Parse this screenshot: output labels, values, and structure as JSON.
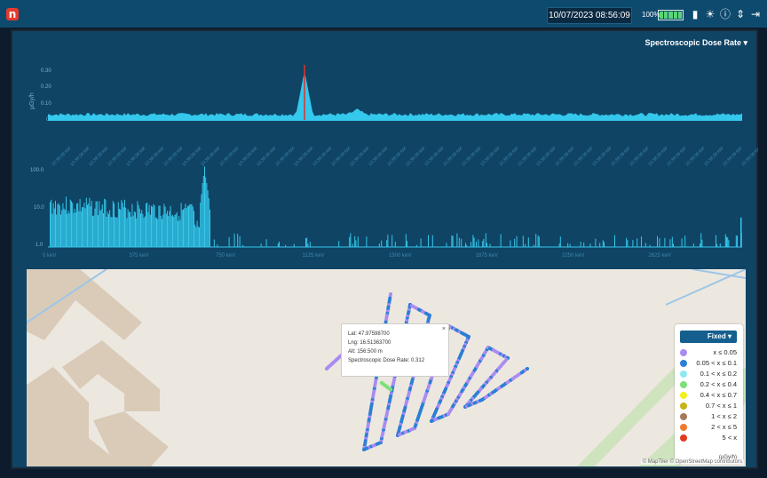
{
  "header": {
    "logo_letter": "n",
    "datetime": "10/07/2023 08:56:09",
    "battery_pct": "100%",
    "battery_level": 1.0
  },
  "colors": {
    "topbar": "#0e4a6e",
    "panel": "#0f4465",
    "series": "#34c8ec",
    "marker": "#e0312b"
  },
  "metric_selector": {
    "label": "Spectroscopic Dose Rate ▾"
  },
  "dose_chart": {
    "y_axis_label": "µGy/h",
    "y_ticks": [
      "0.30",
      "0.20",
      "0.10",
      "0"
    ],
    "ylim": [
      0,
      0.35
    ],
    "x_tick_label_sample": "10:38:09 AM",
    "x_tick_count": 38,
    "peak_value": 0.312,
    "baseline_value": 0.03
  },
  "spectrum_chart": {
    "y_ticks": [
      "100.0",
      "10.0",
      "1.0"
    ],
    "x_ticks": [
      "0 keV",
      "375 keV",
      "750 keV",
      "1125 keV",
      "1500 keV",
      "1875 keV",
      "2250 keV",
      "2625 keV"
    ],
    "scale": "log"
  },
  "popup": {
    "lat": "Lat: 47.97598700",
    "lng": "Lng: 16.51363700",
    "alt": "Alt: 156.500 m",
    "dose": "Spectroscopic Dose Rate: 0.312",
    "close": "×"
  },
  "legend": {
    "mode": "Fixed ▾",
    "unit": "(µGy/h)",
    "items": [
      {
        "label": "x ≤ 0.05",
        "color": "#a98cf2"
      },
      {
        "label": "0.05 < x ≤ 0.1",
        "color": "#2b7fd6"
      },
      {
        "label": "0.1 < x ≤ 0.2",
        "color": "#8ee8f2"
      },
      {
        "label": "0.2 < x ≤ 0.4",
        "color": "#7ee07a"
      },
      {
        "label": "0.4 < x ≤ 0.7",
        "color": "#f2f01e"
      },
      {
        "label": "0.7 < x ≤ 1",
        "color": "#c7b21a"
      },
      {
        "label": "1 < x ≤ 2",
        "color": "#a8785a"
      },
      {
        "label": "2 < x ≤ 5",
        "color": "#f07a2a"
      },
      {
        "label": "5 < x",
        "color": "#e33a1f"
      }
    ]
  },
  "map": {
    "attribution": "© MapTiler © OpenStreetMap contributors"
  }
}
